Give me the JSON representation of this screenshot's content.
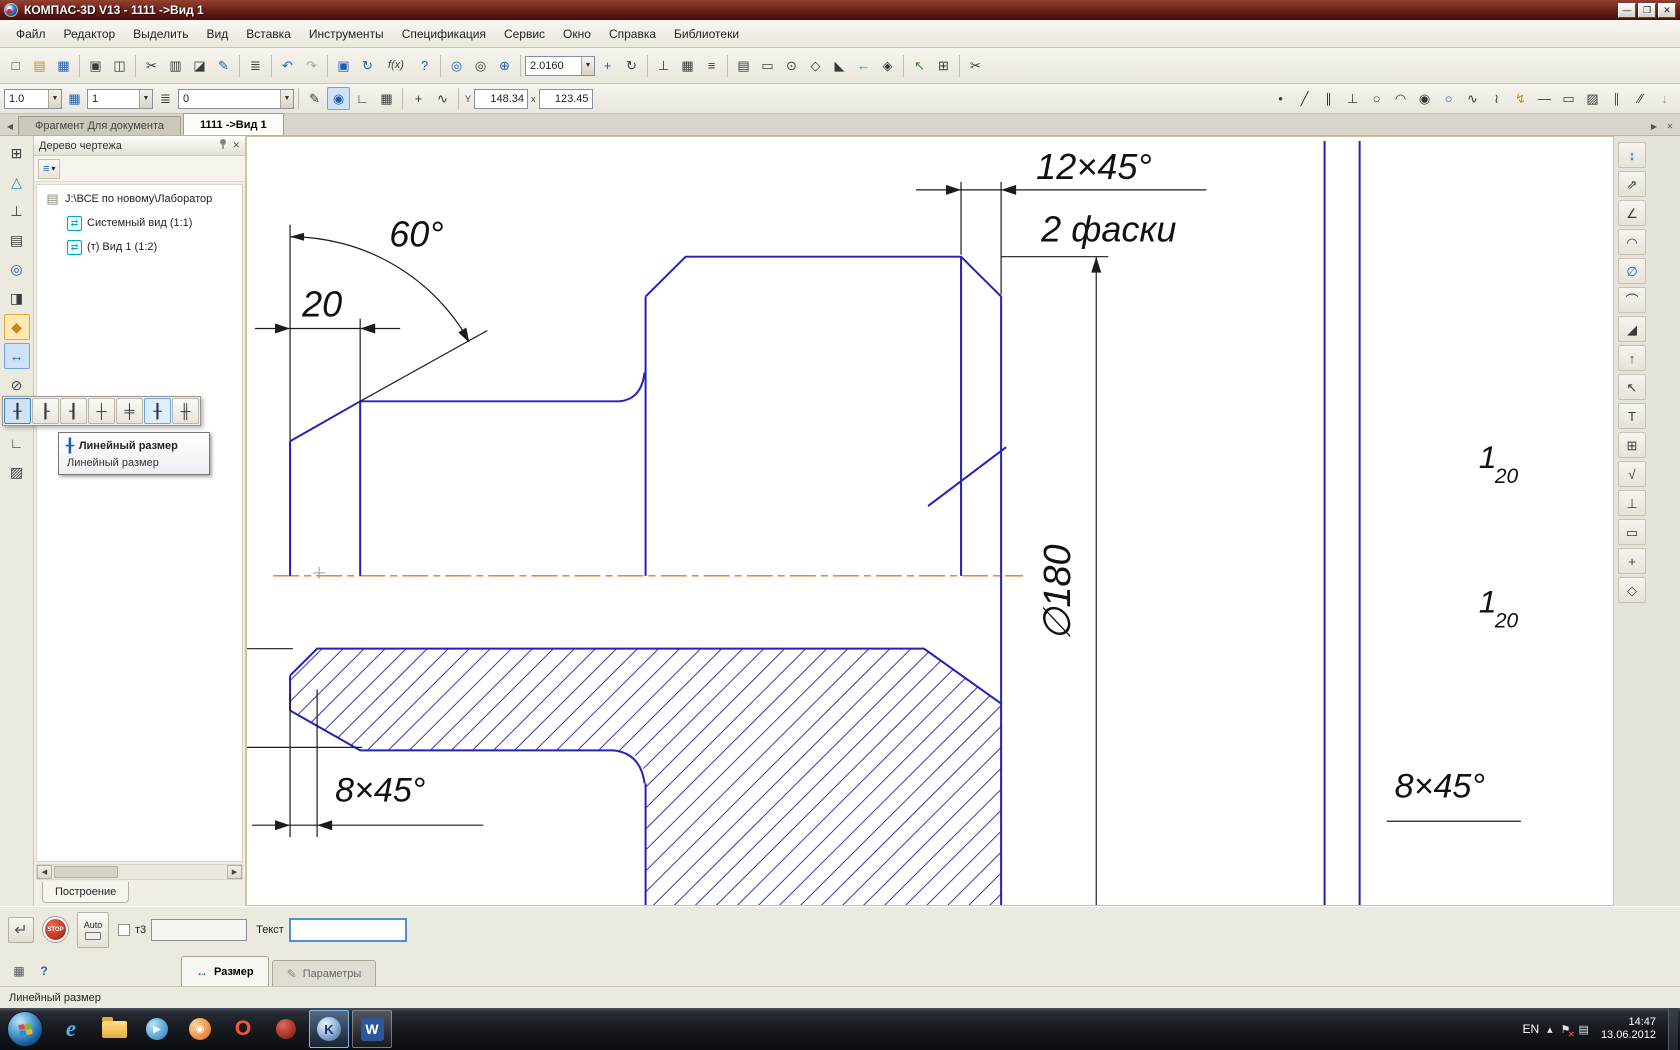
{
  "window": {
    "title": "КОМПАС-3D V13 - 1111 ->Вид 1",
    "minimize": "—",
    "maximize": "❐",
    "close": "✕"
  },
  "menu": {
    "items": [
      "Файл",
      "Редактор",
      "Выделить",
      "Вид",
      "Вставка",
      "Инструменты",
      "Спецификация",
      "Сервис",
      "Окно",
      "Справка",
      "Библиотеки"
    ]
  },
  "toolbar1": {
    "zoom": "2.0160",
    "iconsA": [
      {
        "n": "new-icon",
        "g": "□"
      },
      {
        "n": "open-icon",
        "g": "▤",
        "cls": "amber"
      },
      {
        "n": "save-icon",
        "g": "▦",
        "cls": "blue"
      },
      {
        "n": "sep",
        "g": "",
        "cls": "sepi"
      },
      {
        "n": "print-icon",
        "g": "▣"
      },
      {
        "n": "preview-icon",
        "g": "◫"
      },
      {
        "n": "sep",
        "g": "",
        "cls": "sepi"
      },
      {
        "n": "cut-icon",
        "g": "✂"
      },
      {
        "n": "copy-icon",
        "g": "▥"
      },
      {
        "n": "paste-icon",
        "g": "◪"
      },
      {
        "n": "brush-icon",
        "g": "✎",
        "cls": "blue"
      },
      {
        "n": "sep",
        "g": "",
        "cls": "sepi"
      },
      {
        "n": "spec-icon",
        "g": "≣"
      },
      {
        "n": "sep",
        "g": "",
        "cls": "sepi"
      },
      {
        "n": "undo-icon",
        "g": "↶",
        "cls": "blue"
      },
      {
        "n": "redo-icon",
        "g": "↷",
        "cls": "gray"
      },
      {
        "n": "sep",
        "g": "",
        "cls": "sepi"
      },
      {
        "n": "screen-icon",
        "g": "▣",
        "cls": "blue"
      },
      {
        "n": "refresh-icon",
        "g": "↻",
        "cls": "blue"
      },
      {
        "n": "fx-icon",
        "g": "f(x)",
        "cls": "wide"
      },
      {
        "n": "context-help-icon",
        "g": "?",
        "cls": "blue"
      },
      {
        "n": "sep",
        "g": "",
        "cls": "sepi"
      },
      {
        "n": "zoom-in-icon",
        "g": "◎",
        "cls": "blue"
      },
      {
        "n": "zoom-frame-icon",
        "g": "◎"
      },
      {
        "n": "zoom-point-icon",
        "g": "⊕",
        "cls": "blue"
      },
      {
        "n": "sep",
        "g": "",
        "cls": "sepi"
      }
    ],
    "iconsB": [
      {
        "n": "pan-icon",
        "g": "+",
        "cls": "blue"
      },
      {
        "n": "rotate-icon",
        "g": "↻"
      },
      {
        "n": "sep",
        "g": "",
        "cls": "sepi"
      },
      {
        "n": "ortho-icon",
        "g": "⊥"
      },
      {
        "n": "snap-grid-icon",
        "g": "▦"
      },
      {
        "n": "assoc-icon",
        "g": "≡"
      },
      {
        "n": "sep",
        "g": "",
        "cls": "sepi"
      },
      {
        "n": "layout-icon",
        "g": "▤"
      },
      {
        "n": "note-icon",
        "g": "▭"
      },
      {
        "n": "round-icon",
        "g": "⊙"
      },
      {
        "n": "diamond-icon",
        "g": "◇"
      },
      {
        "n": "slope-icon",
        "g": "◣"
      },
      {
        "n": "arrow-left-icon",
        "g": "←",
        "cls": "teal"
      },
      {
        "n": "insert-view-icon",
        "g": "◈"
      },
      {
        "n": "sep",
        "g": "",
        "cls": "sepi"
      },
      {
        "n": "pointer-icon",
        "g": "↖",
        "cls": "green"
      },
      {
        "n": "table-icon",
        "g": "⊞"
      },
      {
        "n": "sep",
        "g": "",
        "cls": "sepi"
      },
      {
        "n": "trim-icon",
        "g": "✂"
      }
    ]
  },
  "toolbar2": {
    "linewidth": "1.0",
    "step": "1",
    "layer": "0",
    "coord_x": "148.34",
    "coord_y": "123.45",
    "coord_label_y": "Y",
    "coord_label_x": "x",
    "iconsL": [
      {
        "n": "sep",
        "g": "",
        "cls": "sepi"
      },
      {
        "n": "style-icon",
        "g": "✎"
      },
      {
        "n": "snap-round-icon",
        "g": "◉",
        "cls": "blue pressed"
      },
      {
        "n": "angle-snap-icon",
        "g": "∟"
      },
      {
        "n": "grid-icon",
        "g": "▦"
      },
      {
        "n": "sep",
        "g": "",
        "cls": "sepi"
      },
      {
        "n": "local-cs-icon",
        "g": "+"
      },
      {
        "n": "ruler-icon",
        "g": "∿"
      },
      {
        "n": "sep",
        "g": "",
        "cls": "sepi"
      }
    ],
    "iconsR": [
      {
        "n": "point-icon",
        "g": "•"
      },
      {
        "n": "aux-line-icon",
        "g": "╱"
      },
      {
        "n": "parallel-icon",
        "g": "∥"
      },
      {
        "n": "perpendicular-icon",
        "g": "⊥"
      },
      {
        "n": "circle-icon",
        "g": "○"
      },
      {
        "n": "arc-icon",
        "g": "◠"
      },
      {
        "n": "circle-point-icon",
        "g": "◉"
      },
      {
        "n": "ellipse-icon",
        "g": "○",
        "cls": "blue"
      },
      {
        "n": "spline-icon",
        "g": "∿"
      },
      {
        "n": "bezier-icon",
        "g": "≀"
      },
      {
        "n": "lightning-icon",
        "g": "↯",
        "cls": "amber"
      },
      {
        "n": "segment-icon",
        "g": "—"
      },
      {
        "n": "rectangle-icon",
        "g": "▭"
      },
      {
        "n": "hatch-icon",
        "g": "▨"
      },
      {
        "n": "multiline-icon",
        "g": "∥",
        "cls": "blue"
      },
      {
        "n": "slash-icon",
        "g": "∕∕"
      },
      {
        "n": "collect-icon",
        "g": "↓",
        "cls": "gray"
      }
    ]
  },
  "tabs": {
    "items": [
      {
        "n": "tab-fragment",
        "label": "Фрагмент Для документа",
        "cls": ""
      },
      {
        "n": "tab-document",
        "label": "1111 ->Вид 1",
        "cls": "active"
      }
    ],
    "nav_left": "◀",
    "nav_right": "▶",
    "close": "✕"
  },
  "left_strip": {
    "icons": [
      {
        "n": "geometry-panel-icon",
        "g": "⊞"
      },
      {
        "n": "compass-icon",
        "g": "△",
        "cls": "teal"
      },
      {
        "n": "snap-icon",
        "g": "⊥"
      },
      {
        "n": "sheet-icon",
        "g": "▤"
      },
      {
        "n": "circle-tool-icon",
        "g": "◎",
        "cls": "blue"
      },
      {
        "n": "survey-icon",
        "g": "◨"
      },
      {
        "n": "build-icon",
        "g": "◆",
        "cls": "amber hl"
      },
      {
        "n": "dimension-tool-icon",
        "g": "↔",
        "cls": "blue pressed"
      },
      {
        "n": "diameter-icon",
        "g": "⊘"
      },
      {
        "n": "arc-tool-icon",
        "g": "◠"
      },
      {
        "n": "corner-icon",
        "g": "∟"
      },
      {
        "n": "hatch-tool-icon",
        "g": "▨"
      }
    ]
  },
  "right_strip": {
    "icons": [
      {
        "n": "linear-dim-icon",
        "g": "↕",
        "cls": "blue"
      },
      {
        "n": "oblique-dim-icon",
        "g": "⇗"
      },
      {
        "n": "angle-dim-icon",
        "g": "∠"
      },
      {
        "n": "arc-dim-icon",
        "g": "◠"
      },
      {
        "n": "diameter-dim-icon",
        "g": "∅",
        "cls": "blue"
      },
      {
        "n": "radius-dim-icon",
        "g": "⌒"
      },
      {
        "n": "chamfer-dim-icon",
        "g": "◢"
      },
      {
        "n": "height-dim-icon",
        "g": "↑"
      },
      {
        "n": "leader-icon",
        "g": "↖"
      },
      {
        "n": "text-tool-icon",
        "g": "T"
      },
      {
        "n": "table-tool-icon",
        "g": "⊞"
      },
      {
        "n": "roughness-icon",
        "g": "√"
      },
      {
        "n": "datum-icon",
        "g": "⊥"
      },
      {
        "n": "tolerance-frame-icon",
        "g": "▭"
      },
      {
        "n": "centerline-icon",
        "g": "+"
      },
      {
        "n": "marking-icon",
        "g": "◇"
      }
    ]
  },
  "tree": {
    "title": "Дерево чертежа",
    "close": "✕",
    "filter_icon": "≡",
    "filter_arrow": "▾",
    "items": [
      {
        "n": "tree-item-root",
        "label": "J:\\ВСЕ по новому\\Лаборатор",
        "cls": "lvl0 sheet"
      },
      {
        "n": "tree-item-system-view",
        "label": "Системный вид (1:1)",
        "cls": "lvl1 view"
      },
      {
        "n": "tree-item-view1",
        "label": "(т) Вид 1 (1:2)",
        "cls": "lvl1 view"
      }
    ],
    "bottom_tab": "Построение",
    "hs_left": "◀",
    "hs_right": "▶"
  },
  "flyout": {
    "icons": [
      {
        "n": "linear-dim-variant-icon",
        "g": "╂",
        "cls": "pressed"
      },
      {
        "n": "linear-from-line-icon",
        "g": "┠"
      },
      {
        "n": "linear-to-line-icon",
        "g": "┨"
      },
      {
        "n": "linear-chain-icon",
        "g": "┼"
      },
      {
        "n": "linear-base-icon",
        "g": "╪"
      },
      {
        "n": "linear-leader-icon",
        "g": "╂",
        "cls": "hl"
      },
      {
        "n": "linear-arc-icon",
        "g": "╫"
      }
    ],
    "tooltip_icon": "╂",
    "tooltip_title": "Линейный размер",
    "tooltip_sub": "Линейный размер"
  },
  "drawing": {
    "angle": "60°",
    "len": "20",
    "chamfer_top": "12×45°",
    "chamfer_note": "2 фаски",
    "diameter": "∅180",
    "chamfer_bottom_left": "8×45°",
    "chamfer_bottom_right": "8×45°",
    "mark1": "1",
    "mark1_sub": "20",
    "mark2": "1",
    "mark2_sub": "20"
  },
  "propbar": {
    "create_glyph": "↵",
    "stop_label": "STOP",
    "auto_label": "Auto",
    "t3_label": "т3",
    "t3_value": "",
    "text_label": "Текст",
    "text_value": "",
    "grid_icon": "▦",
    "help_icon": "?",
    "tabs": [
      {
        "n": "tab-razmer",
        "label": "Размер",
        "cls": "active",
        "ico": "↔"
      },
      {
        "n": "tab-parametry",
        "label": "Параметры",
        "cls": "inactive",
        "ico": "✎"
      }
    ]
  },
  "status": {
    "text": "Линейный размер"
  },
  "taskbar": {
    "lang": "EN",
    "tray_flag": "⚑",
    "tray_x": "✕",
    "tray_up": "▴",
    "tray_doc": "▤",
    "time": "14:47",
    "date": "13.06.2012",
    "icons": {
      "ie": "e",
      "wmp": "▶",
      "media": "◉",
      "opera": "O",
      "kompas": "K",
      "word": "W"
    }
  }
}
